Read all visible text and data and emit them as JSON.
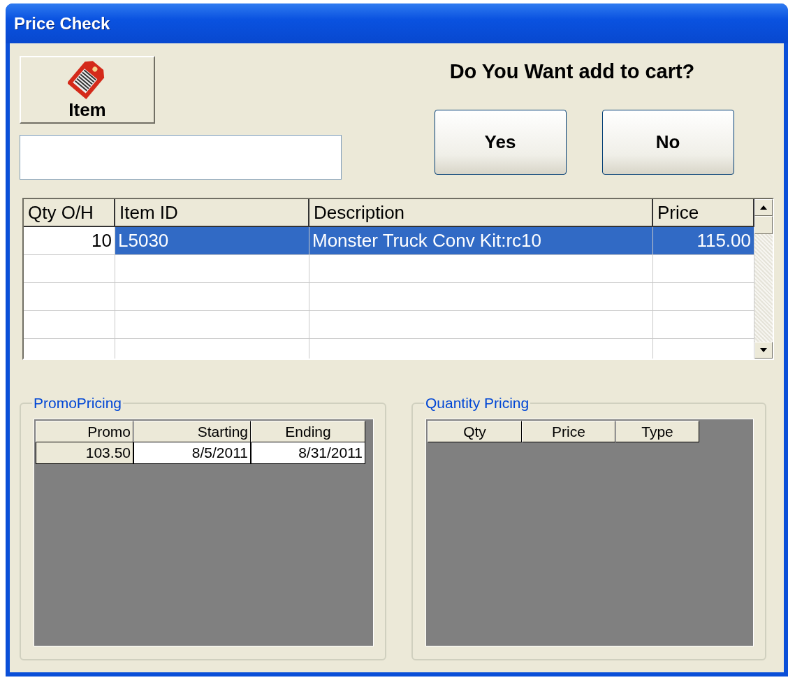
{
  "window": {
    "title": "Price Check"
  },
  "item_button": {
    "label": "Item"
  },
  "prompt": "Do You Want add to cart?",
  "buttons": [
    {
      "label": "Yes"
    },
    {
      "label": "No"
    }
  ],
  "items_table": {
    "columns": [
      "Qty O/H",
      "Item ID",
      "Description",
      "Price"
    ],
    "rows": [
      {
        "cells": [
          "10",
          "L5030",
          "Monster Truck Conv Kit:rc10",
          "115.00"
        ],
        "selected": true
      }
    ]
  },
  "promo_pricing": {
    "title": "PromoPricing",
    "columns": [
      "Promo",
      "Starting",
      "Ending"
    ],
    "rows": [
      {
        "cells": [
          "103.50",
          "8/5/2011",
          "8/31/2011"
        ]
      }
    ]
  },
  "quantity_pricing": {
    "title": "Quantity Pricing",
    "columns": [
      "Qty",
      "Price",
      "Type"
    ]
  }
}
